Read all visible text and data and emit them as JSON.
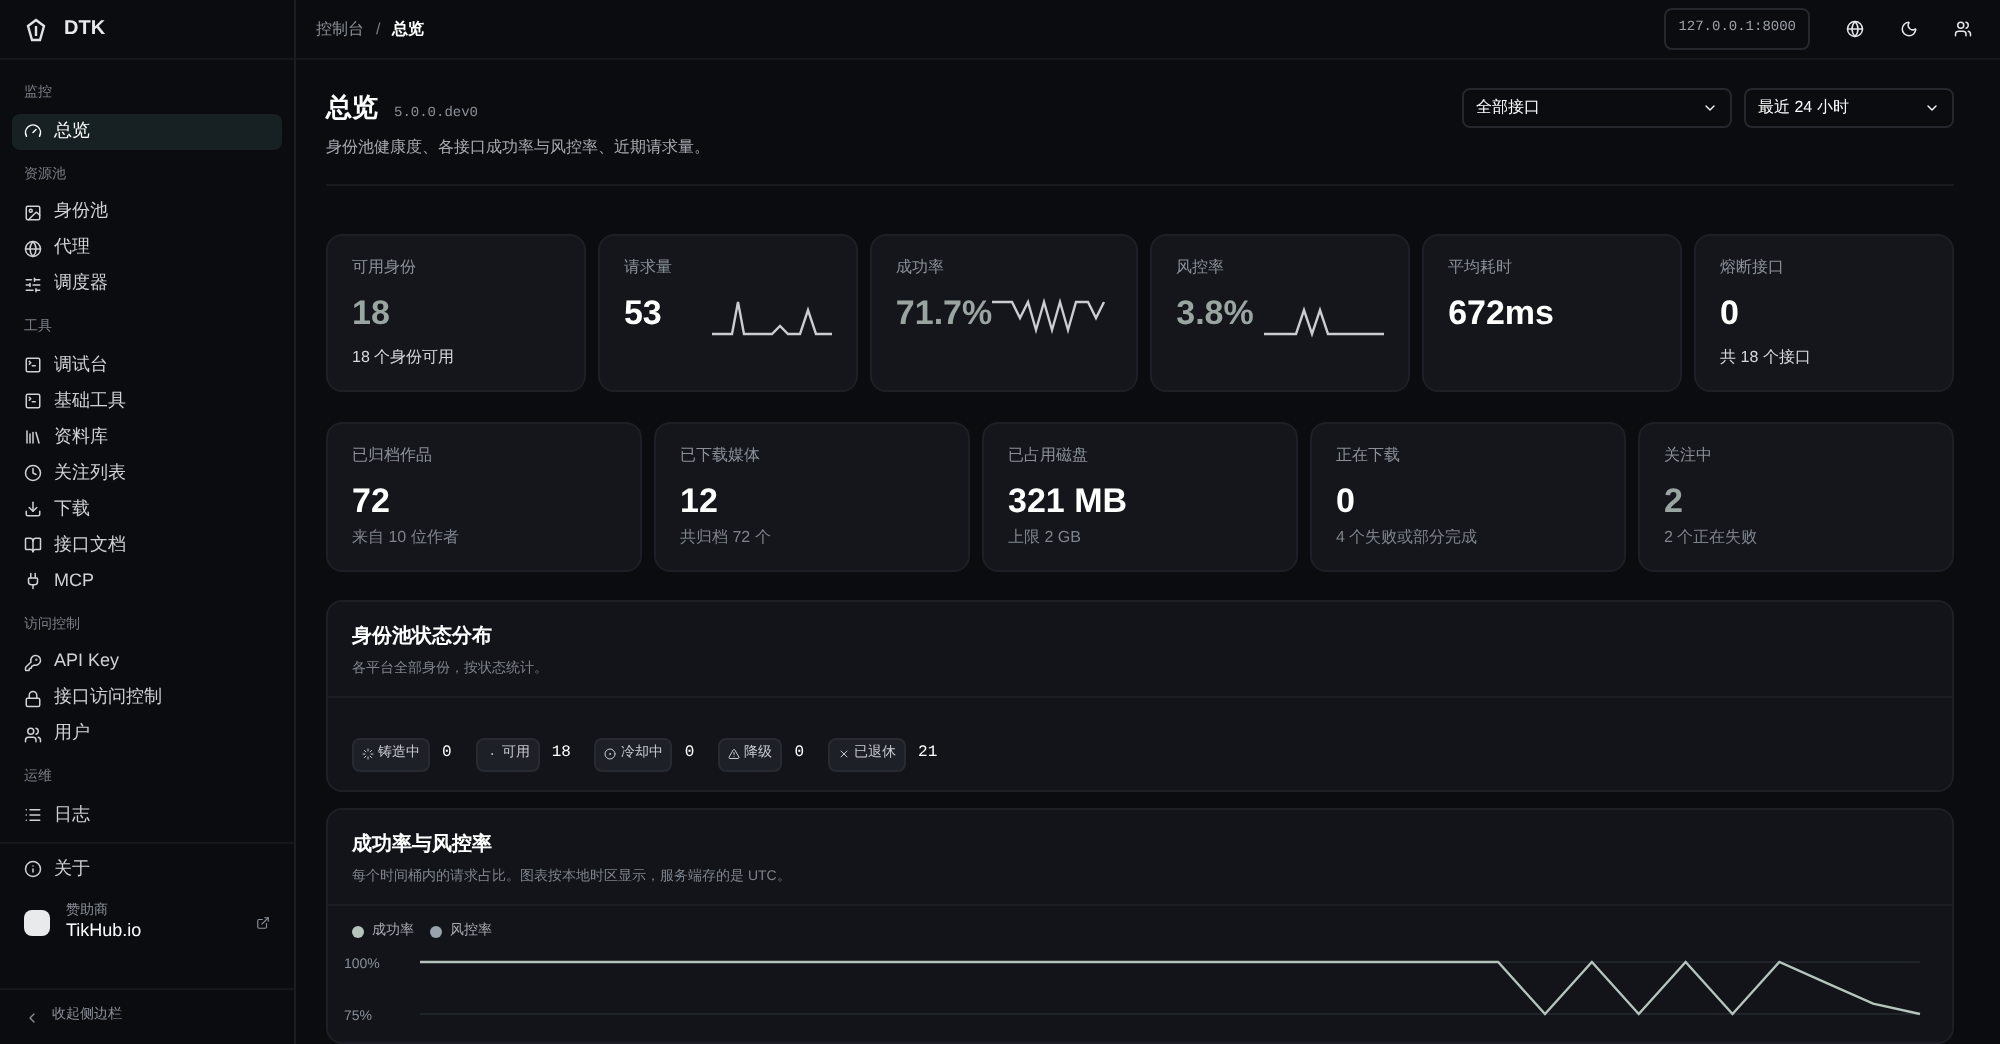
{
  "app": {
    "name": "DTK"
  },
  "sidebar": {
    "sections": [
      {
        "label": "监控",
        "items": [
          {
            "label": "总览",
            "selected": true
          }
        ]
      },
      {
        "label": "资源池",
        "items": [
          {
            "label": "身份池",
            "selected": false
          },
          {
            "label": "代理",
            "selected": false
          },
          {
            "label": "调度器",
            "selected": false
          }
        ]
      },
      {
        "label": "工具",
        "items": [
          {
            "label": "调试台",
            "selected": false
          },
          {
            "label": "基础工具",
            "selected": false
          },
          {
            "label": "资料库",
            "selected": false
          },
          {
            "label": "关注列表",
            "selected": false
          },
          {
            "label": "下载",
            "selected": false
          },
          {
            "label": "接口文档",
            "selected": false
          },
          {
            "label": "MCP",
            "selected": false
          }
        ]
      },
      {
        "label": "访问控制",
        "items": [
          {
            "label": "API Key",
            "selected": false
          },
          {
            "label": "接口访问控制",
            "selected": false
          },
          {
            "label": "用户",
            "selected": false
          }
        ]
      },
      {
        "label": "运维",
        "items": [
          {
            "label": "日志",
            "selected": false
          }
        ]
      }
    ],
    "about": "关于",
    "sponsor": {
      "caption": "赞助商",
      "name": "TikHub.io"
    },
    "collapse": "收起侧边栏"
  },
  "breadcrumb": [
    "控制台",
    "总览"
  ],
  "breadcrumb_separator": "/",
  "topbar": {
    "address": "127.0.0.1:8000"
  },
  "page": {
    "title": "总览",
    "version": "5.0.0.dev0",
    "subtitle": "身份池健康度、各接口成功率与风控率、近期请求量。",
    "filters": [
      "全部接口",
      "最近 24 小时"
    ]
  },
  "stats_row_1": [
    {
      "label": "可用身份",
      "value": "18",
      "muted": true,
      "note": "18 个身份可用"
    },
    {
      "label": "请求量",
      "value": "53",
      "muted": false,
      "sparkline": true
    },
    {
      "label": "成功率",
      "value": "71.7%",
      "muted": true,
      "sparkline": true
    },
    {
      "label": "风控率",
      "value": "3.8%",
      "muted": true,
      "sparkline": true
    },
    {
      "label": "平均耗时",
      "value": "672ms",
      "muted": false
    },
    {
      "label": "熔断接口",
      "value": "0",
      "muted": false,
      "note": "共 18 个接口"
    }
  ],
  "stats_row_2": [
    {
      "label": "已归档作品",
      "value": "72",
      "muted": false,
      "note": "来自 10 位作者"
    },
    {
      "label": "已下载媒体",
      "value": "12",
      "muted": false,
      "note": "共归档 72 个"
    },
    {
      "label": "已占用磁盘",
      "value": "321 MB",
      "muted": false,
      "note": "上限 2 GB"
    },
    {
      "label": "正在下载",
      "value": "0",
      "muted": false,
      "note": "4 个失败或部分完成"
    },
    {
      "label": "关注中",
      "value": "2",
      "muted": true,
      "note": "2 个正在失败"
    }
  ],
  "pool_status": {
    "title": "身份池状态分布",
    "subtitle": "各平台全部身份，按状态统计。",
    "chips": [
      {
        "label": "铸造中",
        "count": "0"
      },
      {
        "label": "可用",
        "count": "18"
      },
      {
        "label": "冷却中",
        "count": "0"
      },
      {
        "label": "降级",
        "count": "0"
      },
      {
        "label": "已退休",
        "count": "21"
      }
    ]
  },
  "rates": {
    "title": "成功率与风控率",
    "subtitle": "每个时间桶内的请求占比。图表按本地时区显示，服务端存的是 UTC。",
    "chart_data": {
      "type": "line",
      "ylim": [
        75,
        100
      ],
      "yticks": [
        {
          "value": 100,
          "label": "100%"
        },
        {
          "value": 75,
          "label": "75%"
        }
      ],
      "series": [
        {
          "name": "成功率",
          "color": "#b4c4bc",
          "values": [
            100,
            100,
            100,
            100,
            100,
            100,
            100,
            100,
            100,
            100,
            100,
            100,
            100,
            100,
            100,
            100,
            100,
            100,
            100,
            100,
            100,
            100,
            100,
            100,
            75,
            100,
            75,
            100,
            75,
            100,
            90,
            80,
            75
          ]
        },
        {
          "name": "风控率",
          "color": "#9aa3ad",
          "values": [
            null,
            null,
            null,
            null,
            null,
            null,
            null,
            null,
            null,
            null,
            null,
            null,
            null,
            null,
            null,
            null,
            null,
            null,
            null,
            null,
            null,
            null,
            null,
            null,
            null,
            null,
            null,
            null,
            null,
            null,
            null,
            null,
            null
          ]
        }
      ]
    }
  }
}
